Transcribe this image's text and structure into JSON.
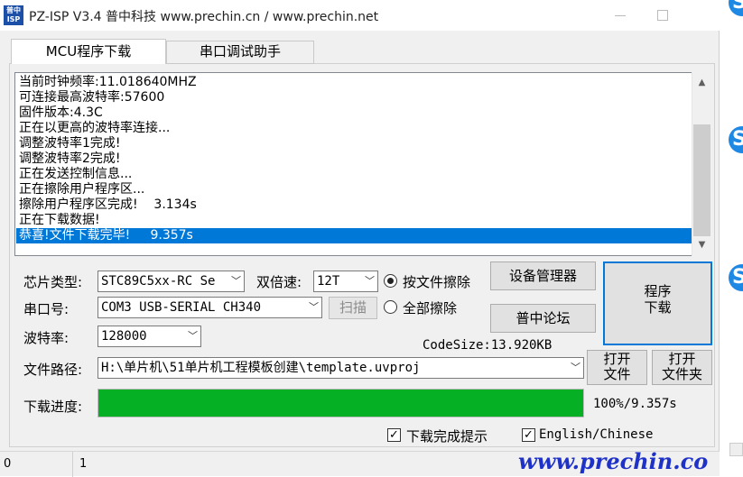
{
  "window": {
    "app_icon_text": "普中ISP",
    "title": "PZ-ISP V3.4  普中科技  www.prechin.cn / www.prechin.net"
  },
  "tabs": [
    {
      "label": "MCU程序下载",
      "active": true
    },
    {
      "label": "串口调试助手",
      "active": false
    }
  ],
  "log": {
    "lines": [
      "当前时钟频率:11.018640MHZ",
      "可连接最高波特率:57600",
      "固件版本:4.3C",
      "正在以更高的波特率连接...",
      "调整波特率1完成!",
      "调整波特率2完成!",
      "正在发送控制信息...",
      "正在擦除用户程序区...",
      "擦除用户程序区完成!    3.134s",
      "正在下载数据!",
      "恭喜!文件下载完毕!     9.357s"
    ],
    "highlight_index": 10,
    "scroll_up": "▲",
    "scroll_down": "▼"
  },
  "chip": {
    "label": "芯片类型:",
    "value": "STC89C5xx-RC Se"
  },
  "double_speed": {
    "label": "双倍速:",
    "value": "12T"
  },
  "erase_options": [
    {
      "label": "按文件擦除",
      "selected": true
    },
    {
      "label": "全部擦除",
      "selected": false
    }
  ],
  "buttons": {
    "device_manager": "设备管理器",
    "forum": "普中论坛",
    "program_download_line1": "程序",
    "program_download_line2": "下载",
    "scan": "扫描",
    "open_file_line1": "打开",
    "open_file_line2": "文件",
    "open_folder_line1": "打开",
    "open_folder_line2": "文件夹"
  },
  "serial_port": {
    "label": "串口号:",
    "value": "COM3  USB-SERIAL CH340"
  },
  "baud": {
    "label": "波特率:",
    "value": "128000"
  },
  "code_size": "CodeSize:13.920KB",
  "file_path": {
    "label": "文件路径:",
    "value": "H:\\单片机\\51单片机工程模板创建\\template.uvproj"
  },
  "progress": {
    "label": "下载进度:",
    "percent": 100,
    "text": "100%/9.357s"
  },
  "checkboxes": [
    {
      "label": "下载完成提示",
      "checked": true
    },
    {
      "label": "English/Chinese",
      "checked": true
    }
  ],
  "status": {
    "field1": "0",
    "field2": "1"
  },
  "watermark": "www.prechin.co",
  "colors": {
    "progress": "#06b025",
    "highlight": "#0078d7",
    "watermark": "#1f32c8"
  }
}
